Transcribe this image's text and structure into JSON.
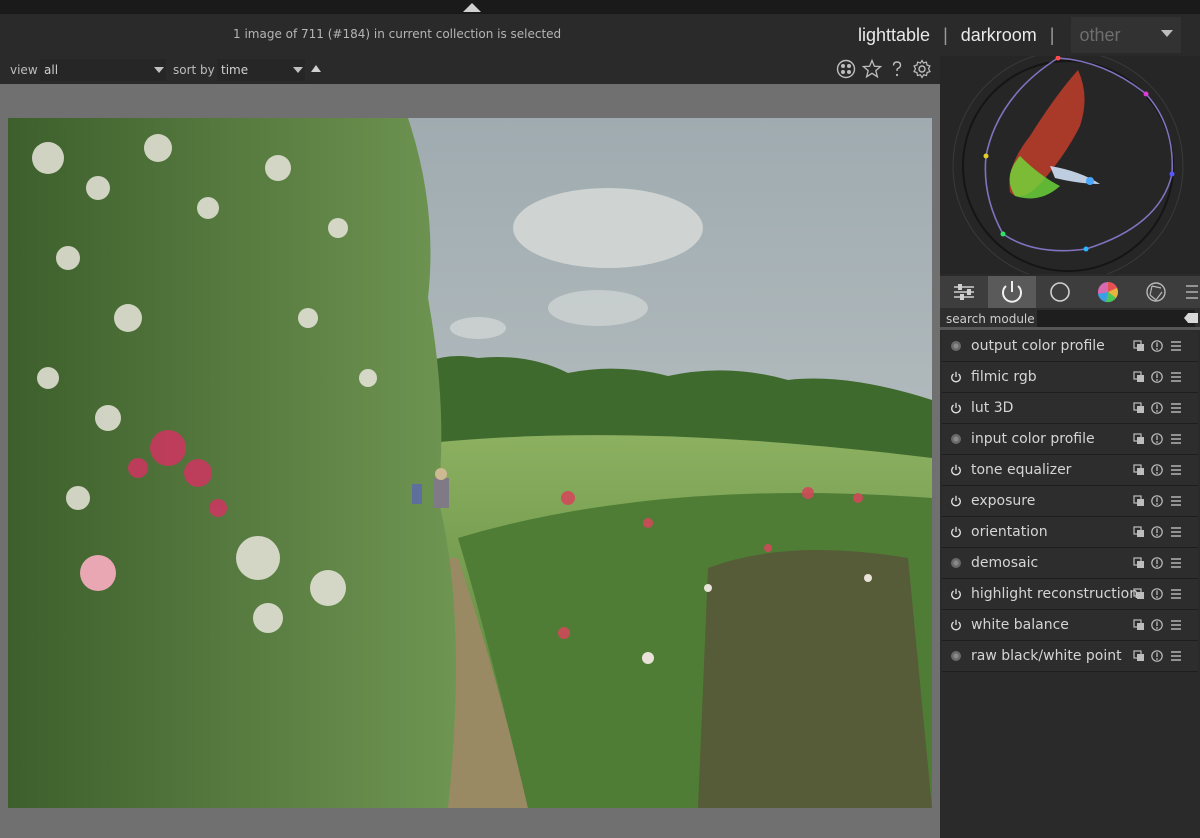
{
  "header": {
    "status": "1 image of 711 (#184) in current collection is selected",
    "views": {
      "lighttable": "lighttable",
      "darkroom": "darkroom",
      "other": "other"
    },
    "separator": "|"
  },
  "filter_bar": {
    "view_label": "view",
    "view_value": "all",
    "sort_label": "sort by",
    "sort_value": "time",
    "icons": [
      "grouping-icon",
      "star-icon",
      "help-icon",
      "gear-icon"
    ]
  },
  "right_panel": {
    "search_label": "search module",
    "search_value": "",
    "tabs": [
      "active-modules-presets-icon",
      "power-icon",
      "circle-icon",
      "color-wheel-icon",
      "aperture-icon",
      "menu-icon"
    ],
    "modules": [
      {
        "name": "output color profile",
        "always_on": true
      },
      {
        "name": "filmic rgb",
        "always_on": false
      },
      {
        "name": "lut 3D",
        "always_on": false
      },
      {
        "name": "input color profile",
        "always_on": true
      },
      {
        "name": "tone equalizer",
        "always_on": false
      },
      {
        "name": "exposure",
        "always_on": false
      },
      {
        "name": "orientation",
        "always_on": false
      },
      {
        "name": "demosaic",
        "always_on": true
      },
      {
        "name": "highlight reconstruction",
        "always_on": false
      },
      {
        "name": "white balance",
        "always_on": false
      },
      {
        "name": "raw black/white point",
        "always_on": true
      }
    ]
  },
  "colors": {
    "background": "#2b2b2b",
    "panel": "#2a2a2a",
    "center_gray": "#707070",
    "text": "#d5d5d5"
  }
}
